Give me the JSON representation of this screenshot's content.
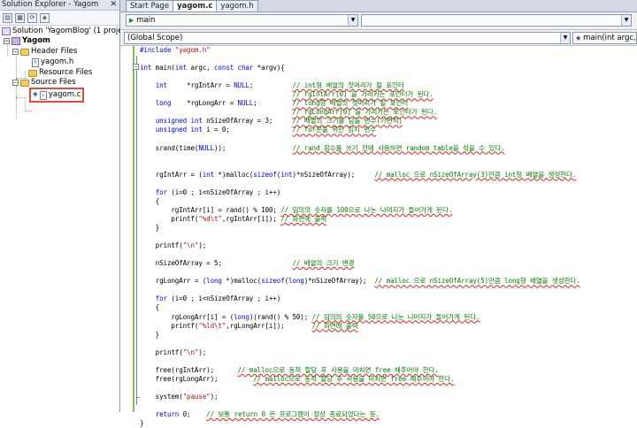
{
  "solution_explorer": {
    "title": "Solution Explorer - Yagom",
    "close": "✕",
    "toolbar_buttons": [
      "properties",
      "show-all-files",
      "refresh",
      "view-class-diagram"
    ],
    "nodes": [
      {
        "label": "Solution 'YagomBlog' (1 projec",
        "kind": "solution"
      },
      {
        "label": "Yagom",
        "kind": "project"
      },
      {
        "label": "Header Files",
        "kind": "folder"
      },
      {
        "label": "yagom.h",
        "kind": "header"
      },
      {
        "label": "Resource Files",
        "kind": "folder"
      },
      {
        "label": "Source Files",
        "kind": "folder"
      },
      {
        "label": "yagom.c",
        "kind": "source",
        "selected": true
      }
    ]
  },
  "tabs": [
    {
      "label": "Start Page",
      "active": false
    },
    {
      "label": "yagom.c",
      "active": true
    },
    {
      "label": "yagom.h",
      "active": false
    }
  ],
  "nav": {
    "function_combo": "main",
    "scope_combo": "(Global Scope)",
    "member_combo": "main(int argc, co"
  },
  "code_lines": [
    "#include \"yagom.h\"",
    "",
    "int main(int argc, const char *argv){",
    "",
    "    int     *rgIntArr = NULL;          // int형 배열의 첫머리가 될 포인터",
    "                                       // rgIntArr[0] 을 가리키는 포인터가 된다.",
    "    long    *rgLongArr = NULL;         // long형 배열의 첫머리가 될 포인터",
    "                                       // rgLongArr[0] 을 가리키는 포인터가 된다.",
    "    unsigned int nSizeOfArray = 3;     // 배열의 크기를 담을 변수(가변적)",
    "    unsigned int i = 0;                // for문을 위한 임시 변수",
    "",
    "    srand(time(NULL));                 // rand 함수를 쓰기 전에 사용하면 random table을 섞을 수 있다.",
    "",
    "",
    "    rgIntArr = (int *)malloc(sizeof(int)*nSizeOfArray);     // malloc 으로 nSizeOfArray(3)만큼 int형 배열을 생성한다.",
    "",
    "    for (i=0 ; i<nSizeOfArray ; i++)",
    "    {",
    "        rgIntArr[i] = rand() % 100; // 임의의 숫자를 100으로 나눈 나머지가 들어가게 된다.",
    "        printf(\"%d\\t\",rgIntArr[i]); // 화면에 출력",
    "    }",
    "",
    "    printf(\"\\n\");",
    "",
    "    nSizeOfArray = 5;                  // 배열의 크기 변경",
    "",
    "    rgLongArr = (long *)malloc(sizeof(long)*nSizeOfArray);  // malloc 으로 nSizeOfArray(5)만큼 long형 배열을 생성한다.",
    "",
    "    for (i=0 ; i<nSizeOfArray ; i++)",
    "    {",
    "        rgLongArr[i] = (long)(rand() % 50); // 임의의 숫자를 50으로 나눈 나머지가 들어가게 된다.",
    "        printf(\"%ld\\t\",rgLongArr[i]);       // 화면에 출력",
    "    }",
    "",
    "    printf(\"\\n\");",
    "",
    "    free(rgIntArr);      // malloc으로 동적 할당 후 사용을 마치면 free 해주어야 한다.",
    "    free(rgLongArr);         // malloc으로 동적 할당 후 사용을 마치면 free 해주어야 한다.",
    "",
    "    system(\"pause\");",
    "",
    "    return 0;    // 보통 return 0 은 프로그램이 정상 종료되었다는 뜻.",
    "}"
  ]
}
